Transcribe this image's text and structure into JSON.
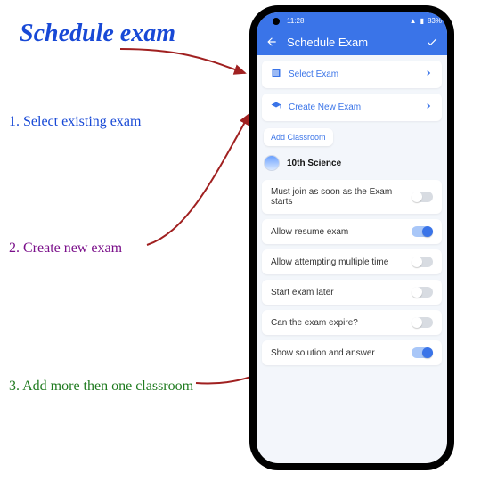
{
  "annotation": {
    "title": "Schedule exam",
    "step1": "1. Select existing exam",
    "step2": "2. Create new exam",
    "step3": "3. Add more then one classroom"
  },
  "statusbar": {
    "time": "11:28",
    "battery": "83%"
  },
  "appbar": {
    "title": "Schedule Exam",
    "back_icon": "arrow-back",
    "confirm_icon": "check"
  },
  "options": {
    "select_exam": "Select Exam",
    "create_exam": "Create New Exam",
    "add_classroom": "Add Classroom"
  },
  "classroom": {
    "name": "10th Science"
  },
  "settings": [
    {
      "label": "Must join as soon as the Exam starts",
      "on": false
    },
    {
      "label": "Allow resume exam",
      "on": true
    },
    {
      "label": "Allow attempting multiple time",
      "on": false
    },
    {
      "label": "Start exam later",
      "on": false
    },
    {
      "label": "Can the exam expire?",
      "on": false
    },
    {
      "label": "Show solution and answer",
      "on": true
    }
  ],
  "colors": {
    "primary": "#3a74e8"
  }
}
